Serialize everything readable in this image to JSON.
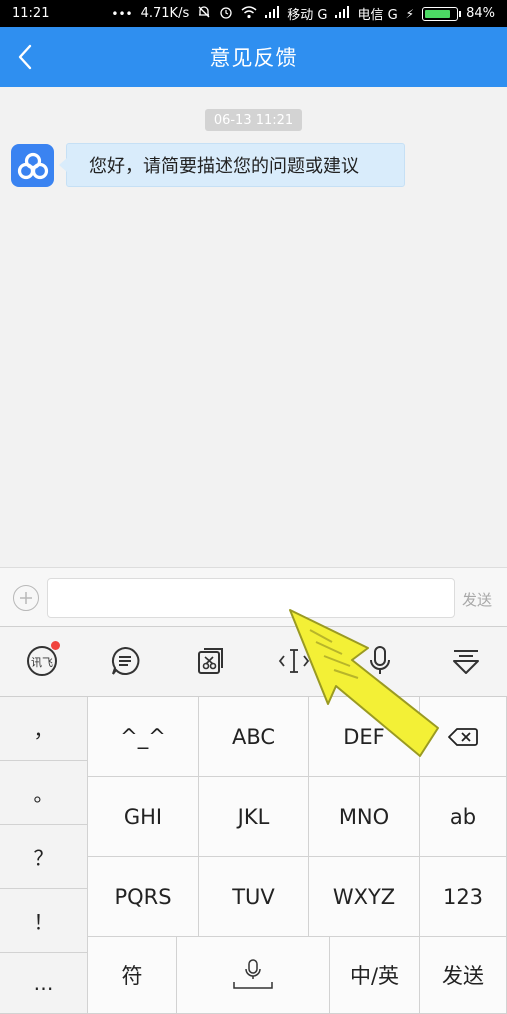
{
  "status_bar": {
    "time": "11:21",
    "speed": "4.71K/s",
    "carrier1": "移动 G",
    "carrier2": "电信 G",
    "battery": "84%",
    "battery_level": 0.84
  },
  "header": {
    "title": "意见反馈",
    "back_icon": "chevron-left-icon"
  },
  "chat": {
    "timestamp": "06-13 11:21",
    "message": "您好，请简要描述您的问题或建议"
  },
  "input_bar": {
    "value": "",
    "placeholder": "",
    "send_label": "发送"
  },
  "keyboard_toolbar": {
    "items": [
      "logo-icon",
      "chat-bubble-icon",
      "clipboard-icon",
      "cursor-icon",
      "microphone-icon",
      "hide-keyboard-icon"
    ]
  },
  "keyboard": {
    "punct": [
      "，",
      "。",
      "？",
      "！",
      "…"
    ],
    "rows": [
      [
        "^_^",
        "ABC",
        "DEF"
      ],
      [
        "GHI",
        "JKL",
        "MNO",
        "ab"
      ],
      [
        "PQRS",
        "TUV",
        "WXYZ",
        "123"
      ]
    ],
    "bottom": {
      "symbols": "符",
      "lang": "中/英",
      "send": "发送"
    }
  }
}
